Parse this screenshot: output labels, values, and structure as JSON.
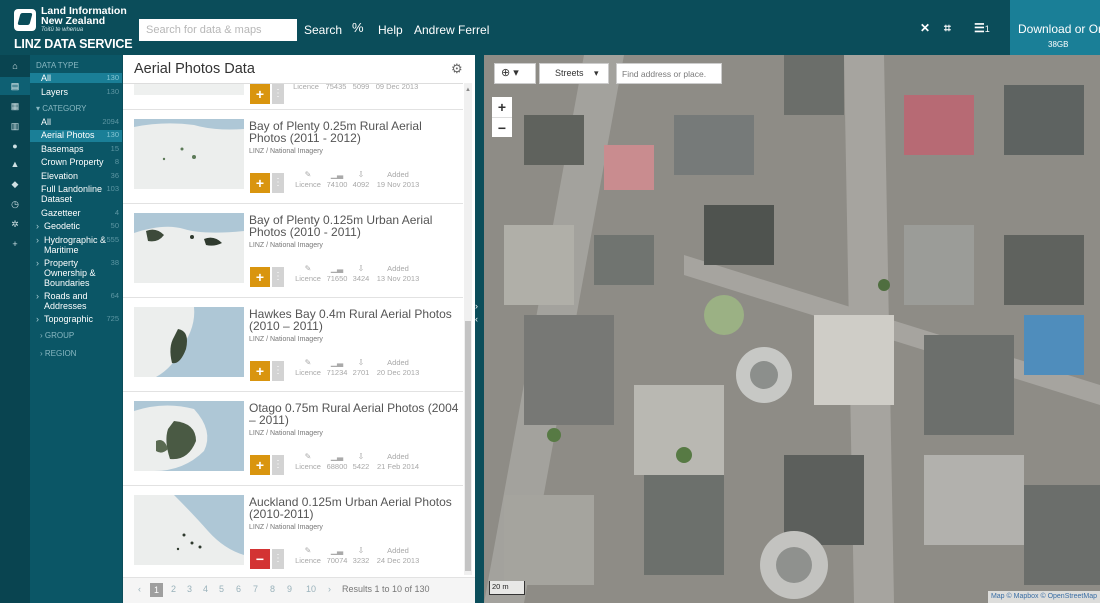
{
  "header": {
    "logo": {
      "line1": "Land Information",
      "line2": "New Zealand",
      "line3": "Toitū te whenua",
      "line4": "LINZ DATA SERVICE"
    },
    "search_placeholder": "Search for data & maps",
    "search_label": "Search",
    "help_label": "Help",
    "user_name": "Andrew Ferrel",
    "list_count": "1",
    "download_label": "Download or Order",
    "download_size": "38GB"
  },
  "filters": {
    "data_type_heading": "DATA TYPE",
    "data_types": [
      {
        "label": "All",
        "count": "130"
      },
      {
        "label": "Layers",
        "count": "130"
      }
    ],
    "category_heading": "CATEGORY",
    "categories": [
      {
        "label": "All",
        "count": "2094"
      },
      {
        "label": "Aerial Photos",
        "count": "130"
      },
      {
        "label": "Basemaps",
        "count": "15"
      },
      {
        "label": "Crown Property",
        "count": "8"
      },
      {
        "label": "Elevation",
        "count": "36"
      },
      {
        "label": "Full Landonline Dataset",
        "count": "103"
      },
      {
        "label": "Gazetteer",
        "count": "4"
      },
      {
        "label": "Geodetic",
        "count": "50"
      },
      {
        "label": "Hydrographic & Maritime",
        "count": "555"
      },
      {
        "label": "Property Ownership & Boundaries",
        "count": "38"
      },
      {
        "label": "Roads and Addresses",
        "count": "64"
      },
      {
        "label": "Topographic",
        "count": "725"
      }
    ],
    "group_heading": "GROUP",
    "region_heading": "REGION"
  },
  "panel": {
    "title": "Aerial Photos Data",
    "stat_labels": {
      "licence": "Licence",
      "added": "Added"
    },
    "items": [
      {
        "title": "",
        "org": "",
        "licence": "75435",
        "views": "5099",
        "date": "09 Dec 2013",
        "added": false
      },
      {
        "title": "Bay of Plenty 0.25m Rural Aerial Photos (2011 - 2012)",
        "org": "LINZ / National Imagery",
        "licence": "74100",
        "views": "4092",
        "date": "19 Nov 2013",
        "added": false
      },
      {
        "title": "Bay of Plenty 0.125m Urban Aerial Photos (2010 - 2011)",
        "org": "LINZ / National Imagery",
        "licence": "71650",
        "views": "3424",
        "date": "13 Nov 2013",
        "added": false
      },
      {
        "title": "Hawkes Bay 0.4m Rural Aerial Photos (2010 – 2011)",
        "org": "LINZ / National Imagery",
        "licence": "71234",
        "views": "2701",
        "date": "20 Dec 2013",
        "added": false
      },
      {
        "title": "Otago 0.75m Rural Aerial Photos (2004 – 2011)",
        "org": "LINZ / National Imagery",
        "licence": "68800",
        "views": "5422",
        "date": "21 Feb 2014",
        "added": false
      },
      {
        "title": "Auckland 0.125m Urban Aerial Photos (2010-2011)",
        "org": "LINZ / National Imagery",
        "licence": "70074",
        "views": "3232",
        "date": "24 Dec 2013",
        "added": true
      }
    ],
    "pagination": {
      "pages": [
        "1",
        "2",
        "3",
        "4",
        "5",
        "6",
        "7",
        "8",
        "9",
        "10"
      ],
      "current": "1",
      "summary": "Results 1 to 10 of 130"
    }
  },
  "map": {
    "basemap": "Streets",
    "address_placeholder": "Find address or place.",
    "scale": "20 m",
    "attribution": "Map © Mapbox © OpenStreetMap"
  },
  "colors": {
    "brand": "#0b4d5a",
    "accent": "#1a7f97",
    "add": "#d9950f",
    "remove": "#d33333"
  }
}
